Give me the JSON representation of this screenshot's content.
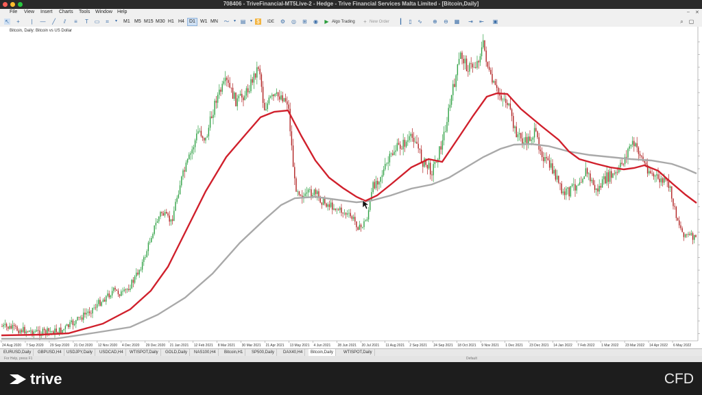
{
  "window": {
    "title": "708406 - TriveFinancial-MT5Live-2 - Hedge - Trive Financial Services Malta Limited - [Bitcoin,Daily]"
  },
  "menu": [
    "File",
    "View",
    "Insert",
    "Charts",
    "Tools",
    "Window",
    "Help"
  ],
  "toolbar": {
    "timeframes": [
      "M1",
      "M5",
      "M15",
      "M30",
      "H1",
      "H4",
      "D1",
      "W1",
      "MN"
    ],
    "active_timeframe": "D1",
    "ide_label": "IDE",
    "algo_trading_label": "Algo Trading",
    "new_order_label": "New Order"
  },
  "chart": {
    "label": "Bitcoin, Daily:  Bitcoin vs US Dollar",
    "colors": {
      "bull": "#2ea043",
      "bear": "#b02020",
      "ma_fast": "#d0202c",
      "ma_slow": "#a9a9a9",
      "grid": "#dcdcdc"
    },
    "x_labels": [
      "24 Aug 2020",
      "7 Sep 2020",
      "29 Sep 2020",
      "21 Oct 2020",
      "12 Nov 2020",
      "4 Dec 2020",
      "29 Dec 2020",
      "21 Jan 2021",
      "12 Feb 2021",
      "8 Mar 2021",
      "30 Mar 2021",
      "21 Apr 2021",
      "13 May 2021",
      "4 Jun 2021",
      "28 Jun 2021",
      "20 Jul 2021",
      "11 Aug 2021",
      "2 Sep 2021",
      "24 Sep 2021",
      "18 Oct 2021",
      "9 Nov 2021",
      "1 Dec 2021",
      "23 Dec 2021",
      "14 Jan 2022",
      "7 Feb 2022",
      "1 Mar 2022",
      "23 Mar 2022",
      "14 Apr 2022",
      "6 May 2022"
    ]
  },
  "tabs": [
    "EURUSD,Daily",
    "GBPUSD,H4",
    "USDJPY,Daily",
    "USDCAD,H4",
    "WTISPOT,Daily",
    "GOLD,Daily",
    "NAS100,H4",
    "Bitcoin,H1",
    "SP500,Daily",
    "DAX40,H4",
    "Bitcoin,Daily",
    "WTISPOT,Daily"
  ],
  "active_tab": "Bitcoin,Daily",
  "status": {
    "help": "For Help, press F1",
    "profile": "Default"
  },
  "banner": {
    "brand": "trive",
    "right_text": "CFD"
  }
}
